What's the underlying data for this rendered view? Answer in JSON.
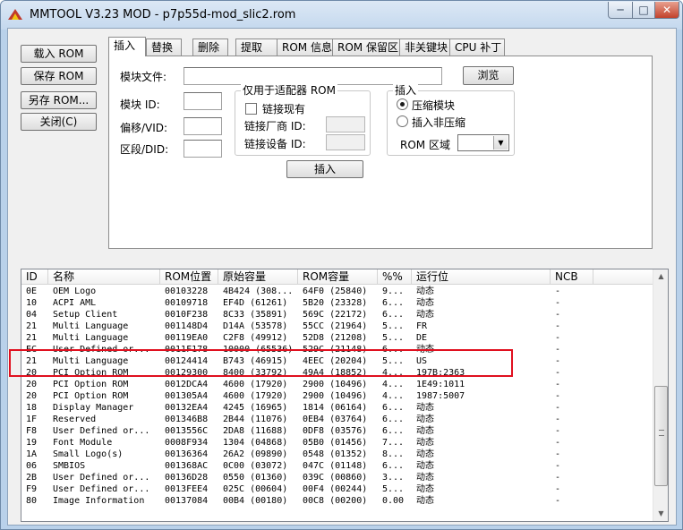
{
  "window": {
    "title": "MMTOOL V3.23 MOD - p7p55d-mod_slic2.rom",
    "min_glyph": "─",
    "max_glyph": "□",
    "close_glyph": "✕"
  },
  "side_buttons": [
    "载入 ROM",
    "保存 ROM",
    "另存 ROM...",
    "关闭(C)"
  ],
  "tabs": [
    "插入",
    "替换",
    "删除",
    "提取",
    "ROM 信息",
    "ROM 保留区",
    "非关键块",
    "CPU 补丁"
  ],
  "insert_panel": {
    "module_file_label": "模块文件:",
    "module_file_value": "",
    "browse_label": "浏览",
    "module_id_label": "模块 ID:",
    "offset_vid_label": "偏移/VID:",
    "segment_did_label": "区段/DID:",
    "adapter_group": {
      "title": "仅用于适配器 ROM",
      "link_existing_label": "链接现有",
      "link_existing_checked": false,
      "vendor_id_label": "链接厂商 ID:",
      "device_id_label": "链接设备 ID:"
    },
    "insert_group": {
      "title": "插入",
      "compressed_label": "压缩模块",
      "uncompressed_label": "插入非压缩",
      "selected": "compressed",
      "rom_region_label": "ROM 区域",
      "rom_region_value": ""
    },
    "insert_button_label": "插入"
  },
  "list": {
    "columns": [
      "ID",
      "名称",
      "ROM位置",
      "原始容量",
      "ROM容量",
      "%%",
      "运行位",
      "NCB"
    ],
    "rows": [
      [
        "0E",
        "OEM Logo",
        "00103228",
        "4B424 (308...",
        "64F0 (25840)",
        "9...",
        "动态",
        "-"
      ],
      [
        "10",
        "ACPI AML",
        "00109718",
        "EF4D (61261)",
        "5B20 (23328)",
        "6...",
        "动态",
        "-"
      ],
      [
        "04",
        "Setup Client",
        "0010F238",
        "8C33 (35891)",
        "569C (22172)",
        "6...",
        "动态",
        "-"
      ],
      [
        "21",
        "Multi Language",
        "001148D4",
        "D14A (53578)",
        "55CC (21964)",
        "5...",
        "FR",
        "-"
      ],
      [
        "21",
        "Multi Language",
        "00119EA0",
        "C2F8 (49912)",
        "52D8 (21208)",
        "5...",
        "DE",
        "-"
      ],
      [
        "EC",
        "User Defined or...",
        "0011F178",
        "10000 (65536)",
        "529C (21148)",
        "6...",
        "动态",
        "-"
      ],
      [
        "21",
        "Multi Language",
        "00124414",
        "B743 (46915)",
        "4EEC (20204)",
        "5...",
        "US",
        "-"
      ],
      [
        "20",
        "PCI Option ROM",
        "00129300",
        "8400 (33792)",
        "49A4 (18852)",
        "4...",
        "197B:2363",
        "-"
      ],
      [
        "20",
        "PCI Option ROM",
        "0012DCA4",
        "4600 (17920)",
        "2900 (10496)",
        "4...",
        "1E49:1011",
        "-"
      ],
      [
        "20",
        "PCI Option ROM",
        "001305A4",
        "4600 (17920)",
        "2900 (10496)",
        "4...",
        "1987:5007",
        "-"
      ],
      [
        "18",
        "Display Manager",
        "00132EA4",
        "4245 (16965)",
        "1814 (06164)",
        "6...",
        "动态",
        "-"
      ],
      [
        "1F",
        "Reserved",
        "001346B8",
        "2B44 (11076)",
        "0EB4 (03764)",
        "6...",
        "动态",
        "-"
      ],
      [
        "F8",
        "User Defined or...",
        "0013556C",
        "2DA8 (11688)",
        "0DF8 (03576)",
        "6...",
        "动态",
        "-"
      ],
      [
        "19",
        "Font Module",
        "0008F934",
        "1304 (04868)",
        "05B0 (01456)",
        "7...",
        "动态",
        "-"
      ],
      [
        "1A",
        "Small Logo(s)",
        "00136364",
        "26A2 (09890)",
        "0548 (01352)",
        "8...",
        "动态",
        "-"
      ],
      [
        "06",
        "SMBIOS",
        "001368AC",
        "0C00 (03072)",
        "047C (01148)",
        "6...",
        "动态",
        "-"
      ],
      [
        "2B",
        "User Defined or...",
        "00136D28",
        "0550 (01360)",
        "039C (00860)",
        "3...",
        "动态",
        "-"
      ],
      [
        "F9",
        "User Defined or...",
        "0013FEE4",
        "025C (00604)",
        "00F4 (00244)",
        "5...",
        "动态",
        "-"
      ],
      [
        "80",
        "Image Information",
        "00137084",
        "00B4 (00180)",
        "00C8 (00200)",
        "0.00",
        "动态",
        "-"
      ]
    ]
  },
  "scrollbar": {
    "up_glyph": "▲",
    "down_glyph": "▼"
  }
}
